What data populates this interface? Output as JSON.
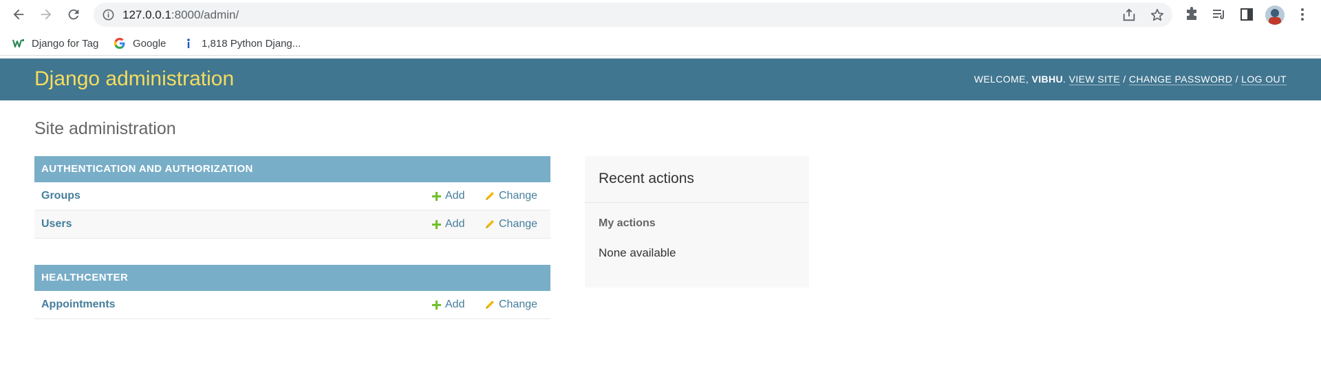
{
  "browser": {
    "url_host": "127.0.0.1",
    "url_rest": ":8000/admin/",
    "bookmarks": [
      {
        "label": "Django for Tag",
        "icon": "w-icon"
      },
      {
        "label": "Google",
        "icon": "google-icon"
      },
      {
        "label": "1,818 Python Djang...",
        "icon": "info-icon"
      }
    ]
  },
  "header": {
    "branding": "Django administration",
    "welcome": "Welcome,",
    "username": "vibhu",
    "view_site": "View site",
    "change_password": "Change password",
    "log_out": "Log out"
  },
  "page_title": "Site administration",
  "modules": [
    {
      "caption": "Authentication and Authorization",
      "rows": [
        {
          "name": "Groups",
          "add": "Add",
          "change": "Change"
        },
        {
          "name": "Users",
          "add": "Add",
          "change": "Change"
        }
      ]
    },
    {
      "caption": "Healthcenter",
      "rows": [
        {
          "name": "Appointments",
          "add": "Add",
          "change": "Change"
        }
      ]
    }
  ],
  "recent_actions": {
    "title": "Recent actions",
    "subtitle": "My actions",
    "empty": "None available"
  },
  "colors": {
    "header_bg": "#417690",
    "branding": "#f5dd5d",
    "caption_bg": "#79aec8",
    "link": "#447e9b",
    "add_icon": "#70bf2b",
    "change_icon": "#efb80b"
  }
}
